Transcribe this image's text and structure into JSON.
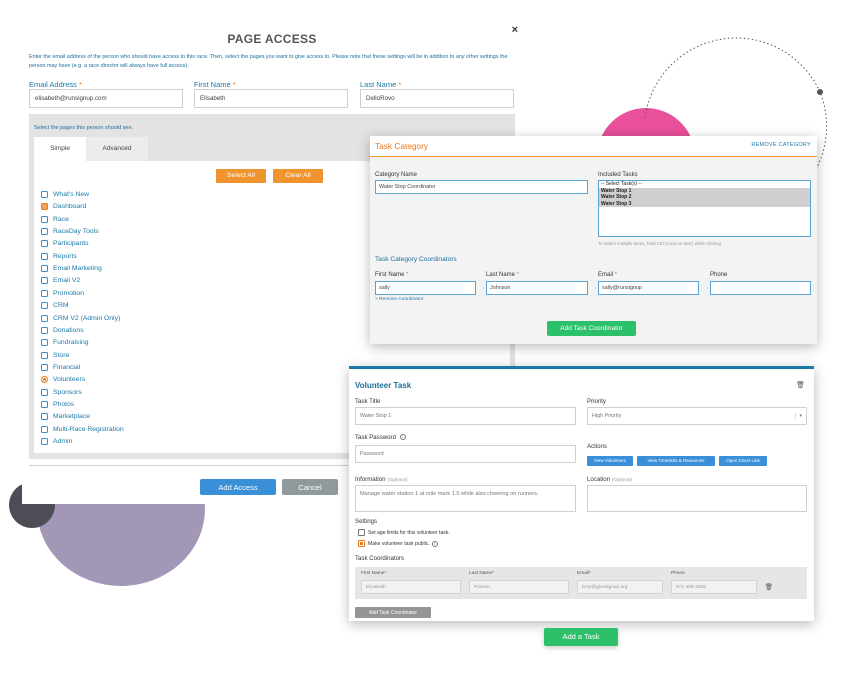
{
  "page_access": {
    "title": "PAGE ACCESS",
    "close_glyph": "×",
    "description": "Enter the email address of the person who should have access to this race. Then, select the pages you want to give access to. Please note that these settings will be in addition to any other settings the person may have (e.g. a race director will always have full access).",
    "email_label": "Email Address",
    "email_value": "elisabeth@runsignup.com",
    "first_name_label": "First Name",
    "first_name_value": "Elisabeth",
    "last_name_label": "Last Name",
    "last_name_value": "DelloRovo",
    "required_mark": "*",
    "select_pages_label": "Select the pages this person should see.",
    "tabs": [
      "Simple",
      "Advanced"
    ],
    "select_all_label": "Select All",
    "clear_all_label": "Clear All",
    "pages": [
      {
        "label": "What's New",
        "state": "unchecked"
      },
      {
        "label": "Dashboard",
        "state": "checked"
      },
      {
        "label": "Race",
        "state": "unchecked"
      },
      {
        "label": "RaceDay Tools",
        "state": "unchecked"
      },
      {
        "label": "Participants",
        "state": "unchecked"
      },
      {
        "label": "Reports",
        "state": "unchecked"
      },
      {
        "label": "Email Marketing",
        "state": "unchecked"
      },
      {
        "label": "Email V2",
        "state": "unchecked"
      },
      {
        "label": "Promotion",
        "state": "unchecked"
      },
      {
        "label": "CRM",
        "state": "unchecked"
      },
      {
        "label": "CRM V2 (Admin Only)",
        "state": "unchecked"
      },
      {
        "label": "Donations",
        "state": "unchecked"
      },
      {
        "label": "Fundraising",
        "state": "unchecked"
      },
      {
        "label": "Store",
        "state": "unchecked"
      },
      {
        "label": "Financial",
        "state": "unchecked"
      },
      {
        "label": "Volunteers",
        "state": "partial"
      },
      {
        "label": "Sponsors",
        "state": "unchecked"
      },
      {
        "label": "Photos",
        "state": "unchecked"
      },
      {
        "label": "Marketplace",
        "state": "unchecked"
      },
      {
        "label": "Multi-Race Registration",
        "state": "unchecked"
      },
      {
        "label": "Admin",
        "state": "unchecked"
      }
    ],
    "add_access_label": "Add Access",
    "cancel_label": "Cancel"
  },
  "task_category": {
    "title": "Task Category",
    "remove_label": "REMOVE CATEGORY",
    "category_name_label": "Category Name",
    "category_name_value": "Water Stop Coordinator",
    "included_tasks_label": "Included Tasks",
    "included_tasks_options": [
      {
        "label": "-- Select Task(s) --",
        "selected": false
      },
      {
        "label": "Water Stop 1",
        "selected": true
      },
      {
        "label": "Water Stop 2",
        "selected": true
      },
      {
        "label": "Water Stop 3",
        "selected": true
      }
    ],
    "hint": "To select multiple items, hold Ctrl (Cmd on Mac) while clicking.",
    "coordinators_label": "Task Category Coordinators",
    "first_name_label": "First Name",
    "last_name_label": "Last Name",
    "email_label": "Email",
    "phone_label": "Phone",
    "required_mark": "*",
    "first_name_value": "sally",
    "last_name_value": "Johnson",
    "email_value": "sally@runsignup",
    "phone_value": "",
    "remove_coordinator_label": "× Remove Coordinator",
    "add_coordinator_label": "Add Task Coordinator"
  },
  "volunteer_task": {
    "title": "Volunteer Task",
    "task_title_label": "Task Title",
    "task_title_value": "Water Stop 1",
    "priority_label": "Priority",
    "priority_value": "High Priority",
    "password_label": "Task Password",
    "password_placeholder": "Password",
    "actions_label": "Actions",
    "actions": [
      "View Volunteers",
      "View Timeslots & Resources",
      "Open Direct Link"
    ],
    "information_label": "Information",
    "location_label": "Location",
    "optional_label": "(Optional)",
    "information_value": "Manage water station 1 at mile mark 1.5 while also cheering on runners.",
    "location_value": "",
    "settings_label": "Settings",
    "settings": [
      {
        "label": "Set age limits for this volunteer task.",
        "checked": false
      },
      {
        "label": "Make volunteer task public.",
        "checked": true
      }
    ],
    "coordinators_label": "Task Coordinators",
    "coord_first_label": "First Name",
    "coord_last_label": "Last Name",
    "coord_email_label": "Email",
    "coord_phone_label": "Phone",
    "required_mark": "*",
    "coord_first_value": "Elizabeth",
    "coord_last_value": "Posson",
    "coord_email_value": "lizzy@givesignup.org",
    "coord_phone_value": "571-409-3286",
    "add_coordinator_label": "Add Task Coordinator",
    "add_task_label": "Add a Task"
  },
  "colors": {
    "accent_orange": "#f0952d",
    "link_blue": "#1b79a8",
    "button_blue": "#3a8fd9",
    "button_green": "#2cc06b",
    "deco_purple": "#a397b8",
    "deco_pink": "#e9519b"
  }
}
